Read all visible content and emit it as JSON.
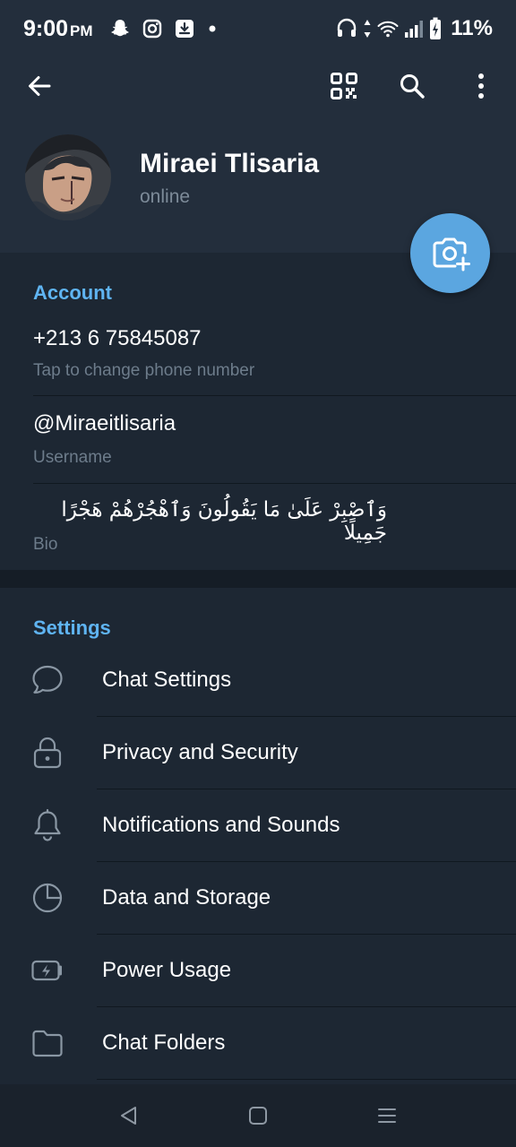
{
  "status_bar": {
    "time": "9:00",
    "ampm": "PM",
    "battery": "11%"
  },
  "profile": {
    "name": "Miraei Tlisaria",
    "status": "online"
  },
  "account": {
    "title": "Account",
    "phone": "+213 6 75845087",
    "phone_hint": "Tap to change phone number",
    "username": "@Miraeitlisaria",
    "username_label": "Username",
    "bio": "وَٱصْبِرْ عَلَىٰ مَا يَقُولُونَ وَٱهْجُرْهُمْ هَجْرًا جَمِيلًا",
    "bio_label": "Bio"
  },
  "settings": {
    "title": "Settings",
    "items": [
      {
        "label": "Chat Settings",
        "icon": "chat-bubble-icon"
      },
      {
        "label": "Privacy and Security",
        "icon": "lock-icon"
      },
      {
        "label": "Notifications and Sounds",
        "icon": "bell-icon"
      },
      {
        "label": "Data and Storage",
        "icon": "pie-chart-icon"
      },
      {
        "label": "Power Usage",
        "icon": "battery-bolt-icon"
      },
      {
        "label": "Chat Folders",
        "icon": "folder-icon"
      }
    ]
  },
  "colors": {
    "accent": "#5fb4f2",
    "fab": "#5ba6e0",
    "background": "#1d2733",
    "header": "#232e3c"
  }
}
